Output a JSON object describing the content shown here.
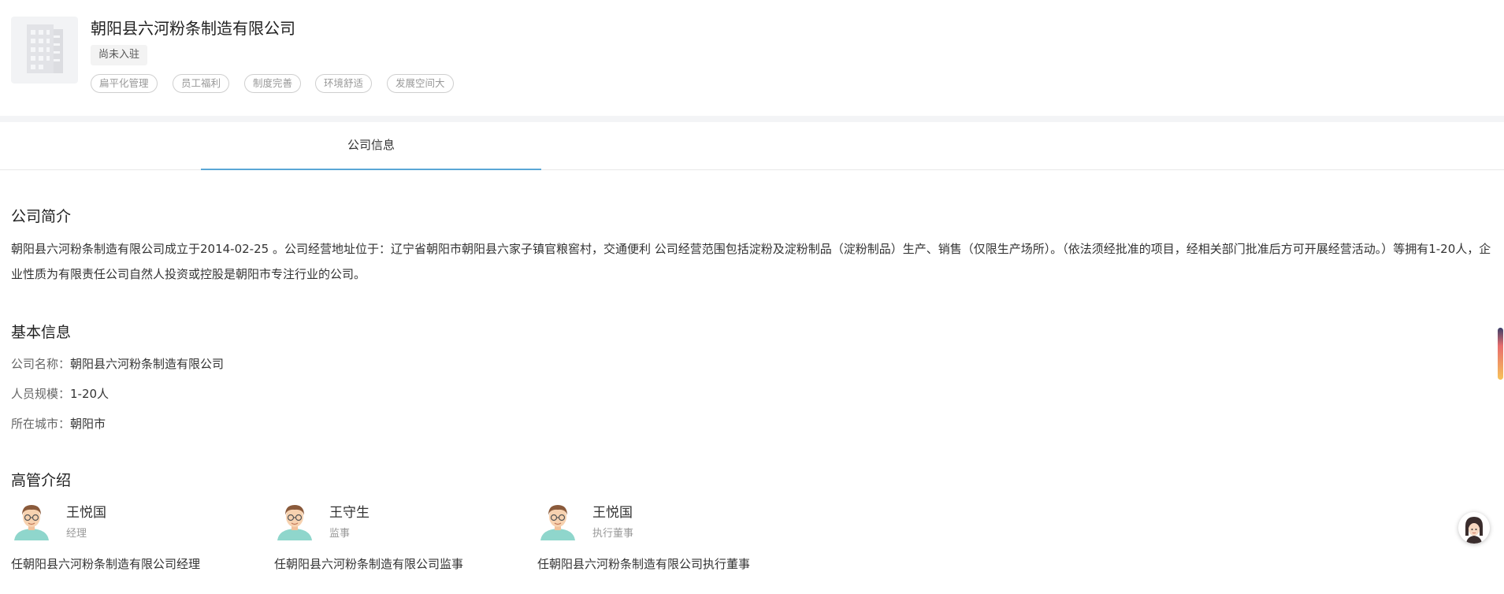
{
  "company": {
    "name": "朝阳县六河粉条制造有限公司",
    "status": "尚未入驻",
    "tags": [
      "扁平化管理",
      "员工福利",
      "制度完善",
      "环境舒适",
      "发展空间大"
    ],
    "logo_icon": "building-icon"
  },
  "tabs": [
    {
      "label": "公司信息",
      "active": true
    }
  ],
  "intro": {
    "title": "公司简介",
    "text": "朝阳县六河粉条制造有限公司成立于2014-02-25 。公司经营地址位于：辽宁省朝阳市朝阳县六家子镇官粮窖村，交通便利 公司经营范围包括淀粉及淀粉制品（淀粉制品）生产、销售（仅限生产场所）。（依法须经批准的项目，经相关部门批准后方可开展经营活动。）等拥有1-20人，企业性质为有限责任公司自然人投资或控股是朝阳市专注行业的公司。"
  },
  "basic": {
    "title": "基本信息",
    "rows": [
      {
        "label": "公司名称：",
        "value": "朝阳县六河粉条制造有限公司"
      },
      {
        "label": "人员规模：",
        "value": "1-20人"
      },
      {
        "label": "所在城市：",
        "value": "朝阳市"
      }
    ]
  },
  "executives": {
    "title": "高管介绍",
    "items": [
      {
        "name": "王悦国",
        "role": "经理",
        "desc": "任朝阳县六河粉条制造有限公司经理"
      },
      {
        "name": "王守生",
        "role": "监事",
        "desc": "任朝阳县六河粉条制造有限公司监事"
      },
      {
        "name": "王悦国",
        "role": "执行董事",
        "desc": "任朝阳县六河粉条制造有限公司执行董事"
      }
    ]
  },
  "colors": {
    "accent": "#5aa7d6",
    "tag_border": "#cfcfcf"
  }
}
